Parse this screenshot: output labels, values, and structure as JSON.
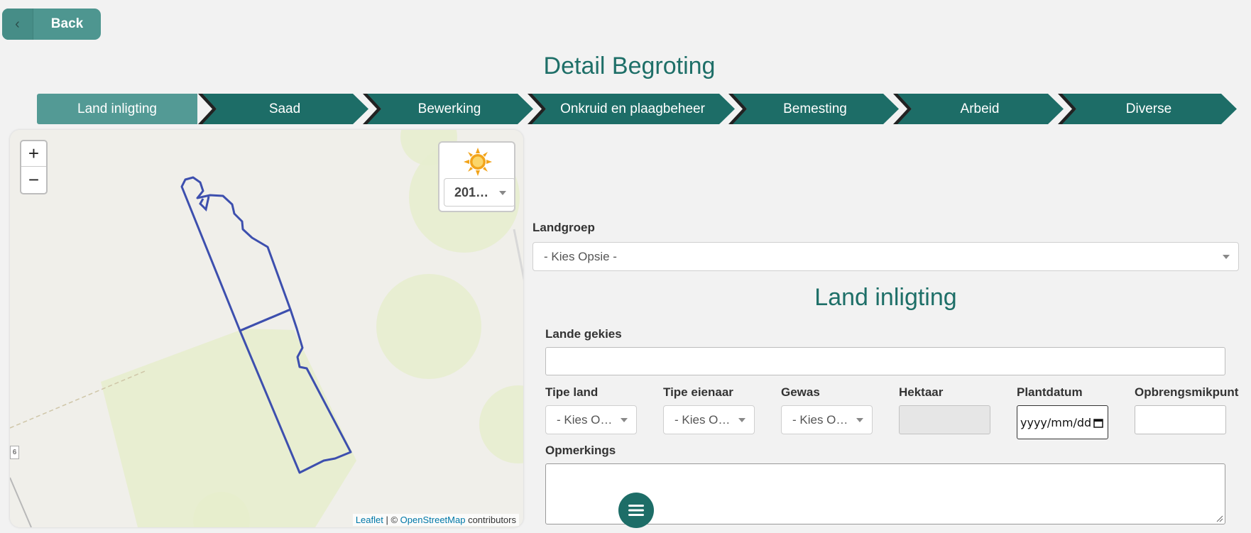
{
  "back": {
    "label": "Back",
    "icon": "chevron-left-icon"
  },
  "page_title": "Detail Begroting",
  "steps": [
    "Land inligting",
    "Saad",
    "Bewerking",
    "Onkruid en plaagbeheer",
    "Bemesting",
    "Arbeid",
    "Diverse"
  ],
  "active_step": "Land inligting",
  "map": {
    "zoom_in": "+",
    "zoom_out": "−",
    "layer_icon": "sun-icon",
    "year_select": "201…",
    "tile_label": "6",
    "attribution": {
      "leaflet": "Leaflet",
      "sep": " | © ",
      "osm": "OpenStreetMap",
      "suffix": " contributors"
    }
  },
  "landgroep": {
    "label": "Landgroep",
    "value": "- Kies Opsie -"
  },
  "section_title": "Land inligting",
  "lande_gekies": {
    "label": "Lande gekies",
    "value": ""
  },
  "fields": {
    "tipe_land": {
      "label": "Tipe land",
      "value": "- Kies O…"
    },
    "tipe_eienaar": {
      "label": "Tipe eienaar",
      "value": "- Kies O…"
    },
    "gewas": {
      "label": "Gewas",
      "value": "- Kies O…"
    },
    "hektaar": {
      "label": "Hektaar",
      "value": ""
    },
    "plantdatum": {
      "label": "Plantdatum",
      "value": "yyyy/mm/dd"
    },
    "opbrengsmikpunt": {
      "label": "Opbrengsmikpunt",
      "value": ""
    }
  },
  "opmerkings": {
    "label": "Opmerkings",
    "value": ""
  },
  "colors": {
    "primary": "#1d6d67",
    "active_step": "#539a95",
    "field_outline": "#3d4fae"
  }
}
